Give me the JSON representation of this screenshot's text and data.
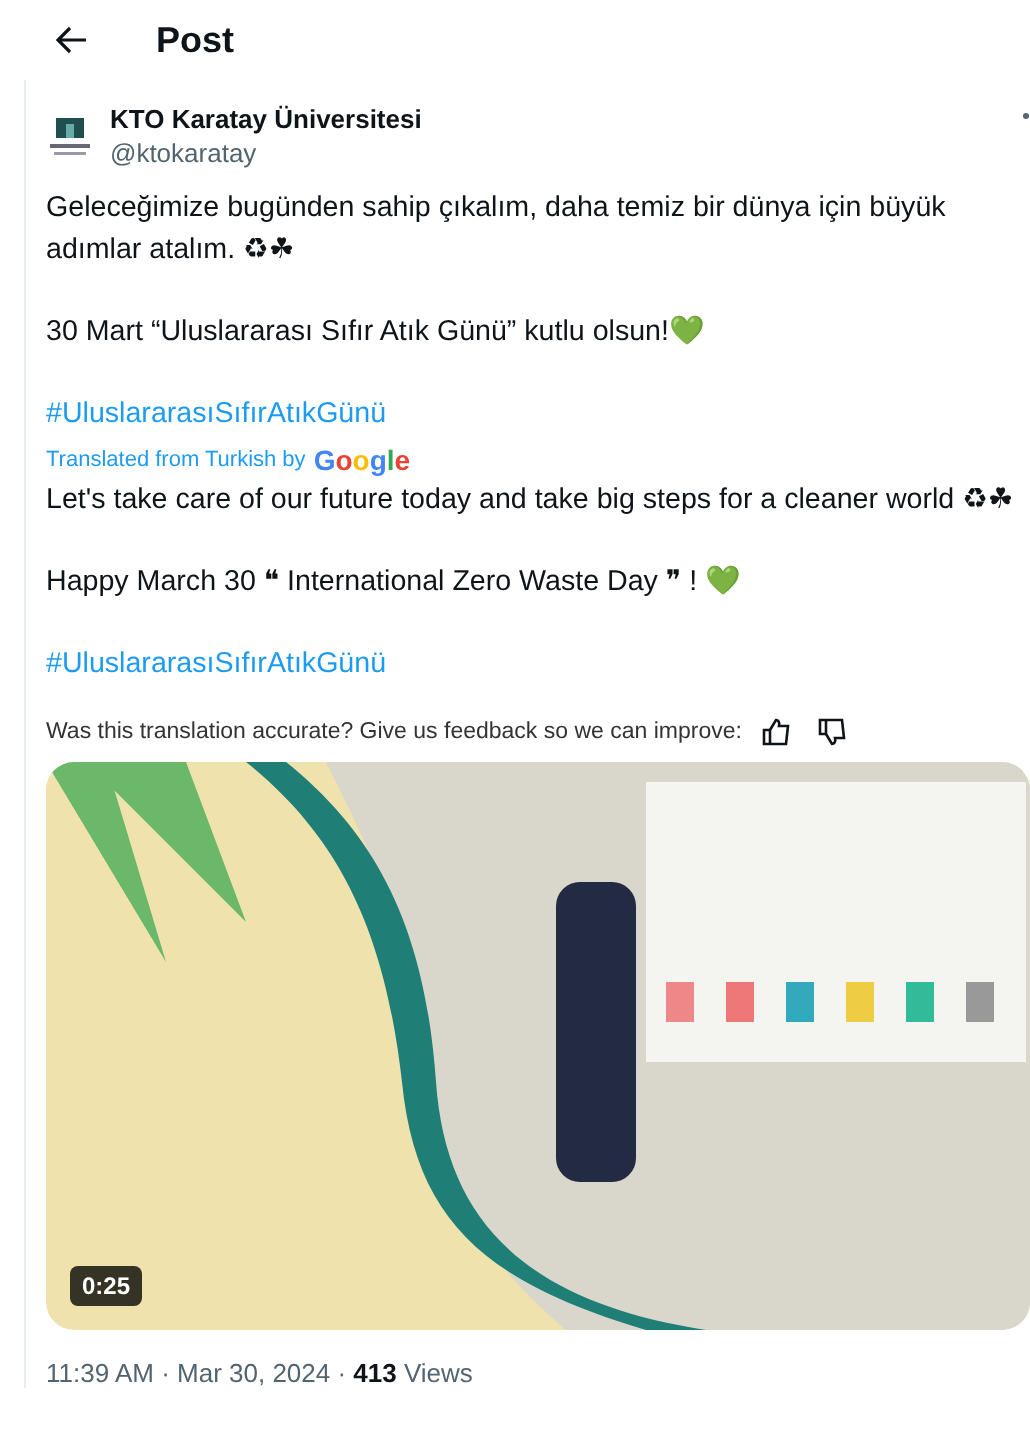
{
  "header": {
    "title": "Post"
  },
  "author": {
    "name": "KTO Karatay Üniversitesi",
    "handle": "@ktokaratay"
  },
  "original": [
    {
      "kind": "text",
      "text": "Geleceğimize bugünden sahip çıkalım, daha temiz bir dünya için büyük adımlar atalım. ♻☘"
    },
    {
      "kind": "text",
      "text": "30 Mart “Uluslararası Sıfır Atık Günü” kutlu olsun!💚"
    },
    {
      "kind": "hashtag",
      "text": "#UluslararasıSıfırAtıkGünü"
    }
  ],
  "translation": {
    "label": "Translated from Turkish by",
    "provider": "Google"
  },
  "translated": [
    {
      "kind": "text",
      "text": "Let's take care of our future today and take big steps for a cleaner world ♻☘"
    },
    {
      "kind": "text",
      "text": "Happy March 30 ❝ International Zero Waste Day ❞ ! 💚"
    },
    {
      "kind": "hashtag",
      "text": "#UluslararasıSıfırAtıkGünü"
    }
  ],
  "feedback": {
    "text": "Was this translation accurate? Give us feedback so we can improve:"
  },
  "video": {
    "duration": "0:25"
  },
  "meta": {
    "text": "11:39 AM · Mar 30, 2024 · **413** Views"
  }
}
